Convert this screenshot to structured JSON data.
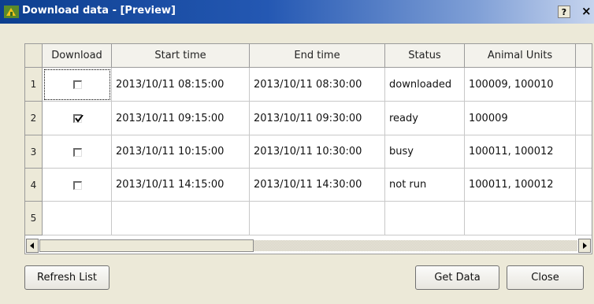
{
  "window": {
    "title": "Download data - [Preview]",
    "help_label": "?",
    "close_label": "×"
  },
  "table": {
    "columns": [
      "Download",
      "Start time",
      "End time",
      "Status",
      "Animal Units"
    ],
    "rows": [
      {
        "num": "1",
        "download": false,
        "start": "2013/10/11 08:15:00",
        "end": "2013/10/11 08:30:00",
        "status": "downloaded",
        "units": "100009, 100010"
      },
      {
        "num": "2",
        "download": true,
        "start": "2013/10/11 09:15:00",
        "end": "2013/10/11 09:30:00",
        "status": "ready",
        "units": "100009"
      },
      {
        "num": "3",
        "download": false,
        "start": "2013/10/11 10:15:00",
        "end": "2013/10/11 10:30:00",
        "status": "busy",
        "units": "100011, 100012"
      },
      {
        "num": "4",
        "download": false,
        "start": "2013/10/11 14:15:00",
        "end": "2013/10/11 14:30:00",
        "status": "not run",
        "units": "100011, 100012"
      },
      {
        "num": "5",
        "download": null,
        "start": "",
        "end": "",
        "status": "",
        "units": ""
      }
    ]
  },
  "buttons": {
    "refresh": "Refresh List",
    "get_data": "Get Data",
    "close": "Close"
  },
  "colors": {
    "title_bar": "#0d3f8f",
    "dialog_bg": "#ece9d8"
  },
  "icons": {
    "app": "app-logo-icon",
    "help": "help-icon",
    "close": "close-icon",
    "scroll_left": "arrow-left-icon",
    "scroll_right": "arrow-right-icon"
  }
}
